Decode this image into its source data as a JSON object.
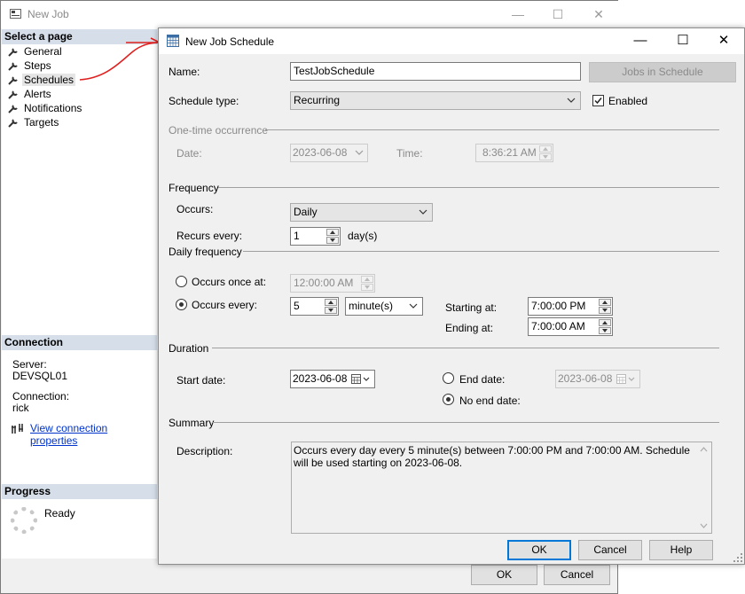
{
  "background_window": {
    "title": "New Job",
    "select_page_header": "Select a page",
    "pages": [
      "General",
      "Steps",
      "Schedules",
      "Alerts",
      "Notifications",
      "Targets"
    ],
    "selected_page": "Schedules",
    "connection_header": "Connection",
    "server_label": "Server:",
    "server_value": "DEVSQL01",
    "connection_label": "Connection:",
    "connection_value": "rick",
    "view_connection_link": "View connection properties",
    "progress_header": "Progress",
    "progress_status": "Ready",
    "ok_label": "OK",
    "cancel_label": "Cancel"
  },
  "dialog": {
    "title": "New Job Schedule",
    "name_label": "Name:",
    "name_value": "TestJobSchedule",
    "jobs_in_schedule_label": "Jobs in Schedule",
    "schedule_type_label": "Schedule type:",
    "schedule_type_value": "Recurring",
    "enabled_label": "Enabled",
    "enabled_checked": true,
    "one_time": {
      "header": "One-time occurrence",
      "date_label": "Date:",
      "date_value": "2023-06-08",
      "time_label": "Time:",
      "time_value": "8:36:21 AM"
    },
    "frequency": {
      "header": "Frequency",
      "occurs_label": "Occurs:",
      "occurs_value": "Daily",
      "recurs_label": "Recurs every:",
      "recurs_value": "1",
      "recurs_unit": "day(s)"
    },
    "daily_frequency": {
      "header": "Daily frequency",
      "once_label": "Occurs once at:",
      "once_value": "12:00:00 AM",
      "every_label": "Occurs every:",
      "every_value": "5",
      "every_unit": "minute(s)",
      "starting_label": "Starting at:",
      "starting_value": "7:00:00 PM",
      "ending_label": "Ending at:",
      "ending_value": "7:00:00 AM",
      "selected": "every"
    },
    "duration": {
      "header": "Duration",
      "start_label": "Start date:",
      "start_value": "2023-06-08",
      "end_label": "End date:",
      "end_value": "2023-06-08",
      "no_end_label": "No end date:",
      "selected": "no_end"
    },
    "summary": {
      "header": "Summary",
      "description_label": "Description:",
      "description": "Occurs every day every 5 minute(s) between 7:00:00 PM and 7:00:00 AM. Schedule will be used starting on 2023-06-08."
    },
    "ok_label": "OK",
    "cancel_label": "Cancel",
    "help_label": "Help"
  },
  "annotation_color": "#e02020"
}
